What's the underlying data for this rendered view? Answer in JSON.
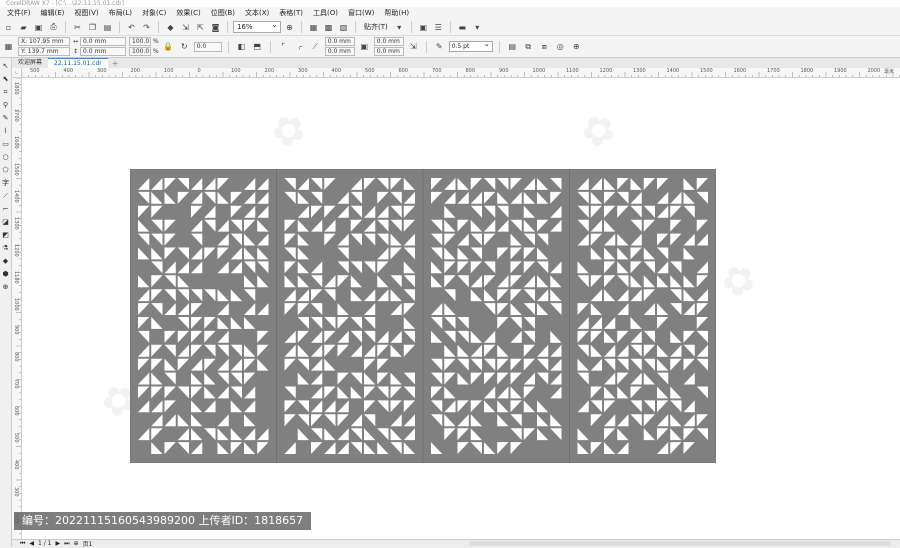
{
  "window": {
    "title": "CorelDRAW X7 - [C:\\...\\22.11.15.01.cdr]"
  },
  "menu": [
    "文件(F)",
    "编辑(E)",
    "视图(V)",
    "布局(L)",
    "对象(C)",
    "效果(C)",
    "位图(B)",
    "文本(X)",
    "表格(T)",
    "工具(O)",
    "窗口(W)",
    "帮助(H)"
  ],
  "toolbar": {
    "zoom": "16%",
    "snap_label": "贴齐(T)"
  },
  "properties": {
    "x": "X: 107.95 mm",
    "y": "Y: 139.7 mm",
    "w": "0.0 mm",
    "h": "0.0 mm",
    "scale_x": "100.0",
    "scale_y": "100.0",
    "pct": "%",
    "rotation": "0.0",
    "corner1": "0.0 mm",
    "corner2": "0.0 mm",
    "corner3": "0.0 mm",
    "corner4": "0.0 mm",
    "outline": "0.5 pt"
  },
  "tabs": [
    "欢迎屏幕",
    "22.11.15.01.cdr"
  ],
  "ruler": {
    "h_labels": [
      "500",
      "400",
      "300",
      "200",
      "100",
      "0",
      "100",
      "200",
      "300",
      "400",
      "500",
      "600",
      "700",
      "800",
      "900",
      "1000",
      "1100",
      "1200",
      "1300",
      "1400",
      "1500",
      "1600",
      "1700",
      "1800",
      "1900",
      "2000"
    ],
    "unit": "毫米",
    "v_labels": [
      "1800",
      "1700",
      "1600",
      "1500",
      "1400",
      "1300",
      "1200",
      "1100",
      "1000",
      "900",
      "800",
      "700",
      "600",
      "500",
      "400",
      "300",
      "200"
    ]
  },
  "status": {
    "page": "1 / 1",
    "page_tab": "页1"
  },
  "overlay": "编号：20221115160543989200 上传者ID：1818657",
  "colors": {
    "panel": "#808080",
    "divider": "#6f6f6f",
    "hole": "#ffffff"
  }
}
